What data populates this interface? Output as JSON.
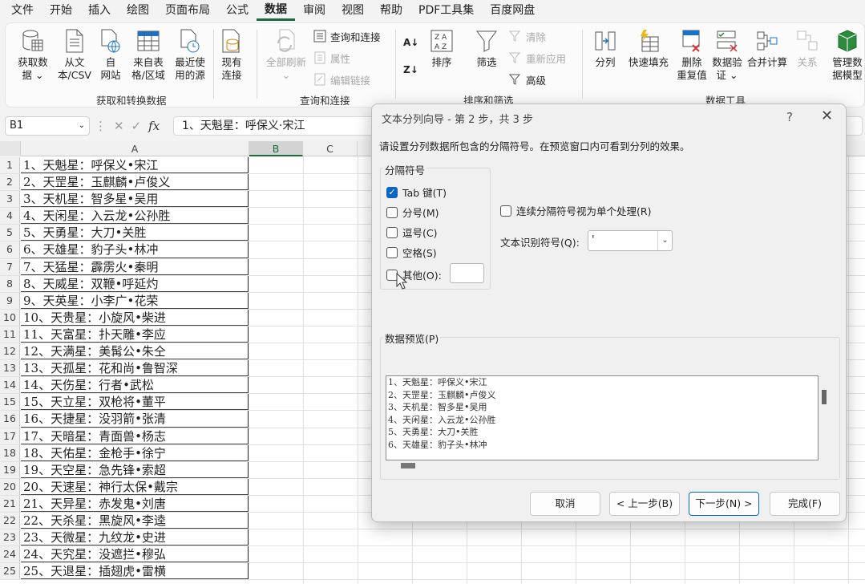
{
  "menu": [
    "文件",
    "开始",
    "插入",
    "绘图",
    "页面布局",
    "公式",
    "数据",
    "审阅",
    "视图",
    "帮助",
    "PDF工具集",
    "百度网盘"
  ],
  "menu_active": "数据",
  "ribbon": {
    "get_data": "获取数",
    "get_data2": "据",
    "from_text": "从文",
    "from_text2": "本/CSV",
    "from_web": "自",
    "from_web2": "网站",
    "from_table": "来自表",
    "from_table2": "格/区域",
    "recent": "最近使",
    "recent2": "用的源",
    "existing": "现有",
    "existing2": "连接",
    "refresh_all": "全部刷新",
    "queries_connections": "查询和连接",
    "properties": "属性",
    "edit_links": "编辑链接",
    "sort": "排序",
    "filter": "筛选",
    "clear": "清除",
    "reapply": "重新应用",
    "advanced": "高级",
    "text_to_columns": "分列",
    "flash_fill": "快速填充",
    "remove_dup": "删除",
    "remove_dup2": "重复值",
    "validation": "数据验",
    "validation2": "证",
    "consolidate": "合并计算",
    "relationships": "关系",
    "data_model": "管理数",
    "data_model2": "据模型",
    "group_get": "获取和转换数据",
    "group_query": "查询和连接",
    "group_sort": "排序和筛选",
    "group_tools": "数据工具"
  },
  "formula_bar": {
    "name_box": "B1",
    "fx": "fx",
    "formula": "1、天魁星：呼保义·宋江"
  },
  "columns": [
    "A",
    "B",
    "C"
  ],
  "rows": [
    {
      "n": "1",
      "a": "1、天魁星：呼保义•宋江"
    },
    {
      "n": "2",
      "a": "2、天罡星：玉麒麟•卢俊义"
    },
    {
      "n": "3",
      "a": "3、天机星：智多星•吴用"
    },
    {
      "n": "4",
      "a": "4、天闲星：入云龙•公孙胜"
    },
    {
      "n": "5",
      "a": "5、天勇星：大刀•关胜"
    },
    {
      "n": "6",
      "a": "6、天雄星：豹子头•林冲"
    },
    {
      "n": "7",
      "a": "7、天猛星：霹雳火•秦明"
    },
    {
      "n": "8",
      "a": "8、天威星：双鞭•呼延灼"
    },
    {
      "n": "9",
      "a": "9、天英星：小李广•花荣"
    },
    {
      "n": "10",
      "a": "10、天贵星：小旋风•柴进"
    },
    {
      "n": "11",
      "a": "11、天富星：扑天雕•李应"
    },
    {
      "n": "12",
      "a": "12、天满星：美髯公•朱仝"
    },
    {
      "n": "13",
      "a": "13、天孤星：花和尚•鲁智深"
    },
    {
      "n": "14",
      "a": "14、天伤星：行者•武松"
    },
    {
      "n": "15",
      "a": "15、天立星：双枪将•董平"
    },
    {
      "n": "16",
      "a": "16、天捷星：没羽箭•张清"
    },
    {
      "n": "17",
      "a": "17、天暗星：青面兽•杨志"
    },
    {
      "n": "18",
      "a": "18、天佑星：金枪手•徐宁"
    },
    {
      "n": "19",
      "a": "19、天空星：急先锋•索超"
    },
    {
      "n": "20",
      "a": "20、天速星：神行太保•戴宗"
    },
    {
      "n": "21",
      "a": "21、天异星：赤发鬼•刘唐"
    },
    {
      "n": "22",
      "a": "22、天杀星：黑旋风•李逵"
    },
    {
      "n": "23",
      "a": "23、天微星：九纹龙•史进"
    },
    {
      "n": "24",
      "a": "24、天究星：没遮拦•穆弘"
    },
    {
      "n": "25",
      "a": "25、天退星：插翅虎•雷横"
    }
  ],
  "dialog": {
    "title": "文本分列向导 - 第 2 步，共 3 步",
    "help": "?",
    "close": "✕",
    "instruction": "请设置分列数据所包含的分隔符号。在预览窗口内可看到分列的效果。",
    "delimiters_label": "分隔符号",
    "tab": "Tab 键(T)",
    "semicolon": "分号(M)",
    "comma": "逗号(C)",
    "space": "空格(S)",
    "other": "其他(O):",
    "consecutive": "连续分隔符号视为单个处理(R)",
    "qualifier_label": "文本识别符号(Q):",
    "qualifier_value": "'",
    "preview_label": "数据预览(P)",
    "preview_lines": [
      "1、天魁星：呼保义•宋江",
      "2、天罡星：玉麒麟•卢俊义",
      "3、天机星：智多星•吴用",
      "4、天闲星：入云龙•公孙胜",
      "5、天勇星：大刀•关胜",
      "6、天雄星：豹子头•林冲"
    ],
    "cancel": "取消",
    "back": "< 上一步(B)",
    "next": "下一步(N) >",
    "finish": "完成(F)"
  },
  "colors": {
    "accent": "#1d6b3a",
    "check": "#0a64c8"
  }
}
